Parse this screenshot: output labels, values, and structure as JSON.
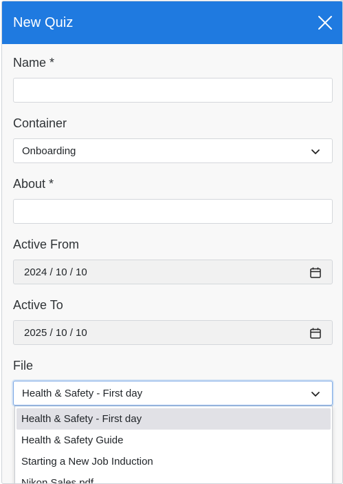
{
  "modal": {
    "title": "New Quiz",
    "close_icon": "close-icon"
  },
  "form": {
    "name": {
      "label": "Name *",
      "value": ""
    },
    "container": {
      "label": "Container",
      "value": "Onboarding"
    },
    "about": {
      "label": "About *",
      "value": ""
    },
    "active_from": {
      "label": "Active From",
      "value": "2024 / 10 / 10"
    },
    "active_to": {
      "label": "Active To",
      "value": "2025 / 10 / 10"
    },
    "file": {
      "label": "File",
      "value": "Health & Safety - First day",
      "options": [
        "Health & Safety - First day",
        "Health & Safety Guide",
        "Starting a New Job Induction",
        "Nikon Sales.pdf"
      ]
    }
  },
  "colors": {
    "header": "#1f7ae0",
    "selected_option": "#e1e1e6"
  }
}
